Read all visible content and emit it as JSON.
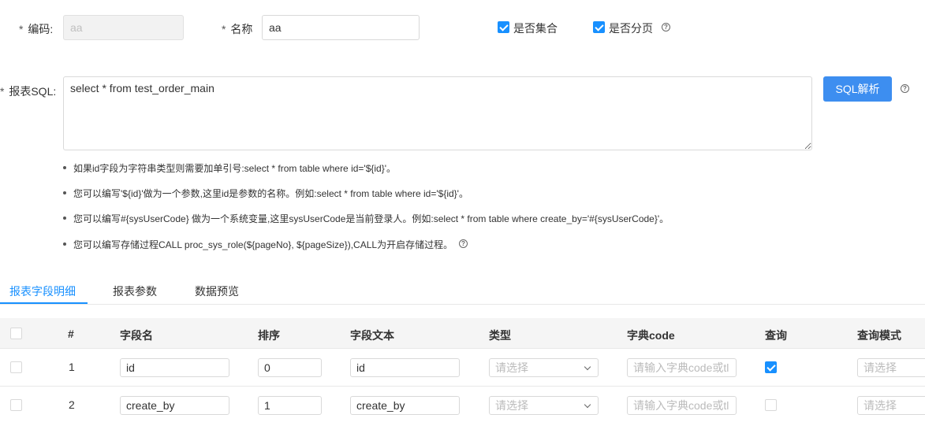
{
  "form": {
    "code_label": "编码:",
    "code_value": "aa",
    "name_label": "名称",
    "name_value": "aa",
    "is_collection_label": "是否集合",
    "is_collection_checked": true,
    "is_paged_label": "是否分页",
    "is_paged_checked": true,
    "sql_label": "报表SQL:",
    "sql_value": "select * from test_order_main",
    "sql_parse_button": "SQL解析",
    "required_mark": "*",
    "help_glyph": "?"
  },
  "tips": [
    "如果id字段为字符串类型则需要加单引号:select * from table where id='${id}'。",
    "您可以编写'${id}'做为一个参数,这里id是参数的名称。例如:select * from table where id='${id}'。",
    "您可以编写#{sysUserCode} 做为一个系统变量,这里sysUserCode是当前登录人。例如:select * from table where create_by='#{sysUserCode}'。",
    "您可以编写存储过程CALL proc_sys_role(${pageNo}, ${pageSize}),CALL为开启存储过程。"
  ],
  "tabs": [
    {
      "label": "报表字段明细",
      "active": true
    },
    {
      "label": "报表参数",
      "active": false
    },
    {
      "label": "数据预览",
      "active": false
    }
  ],
  "table": {
    "columns": [
      "#",
      "字段名",
      "排序",
      "字段文本",
      "类型",
      "字典code",
      "查询",
      "查询模式"
    ],
    "select_placeholder": "请选择",
    "dict_placeholder": "请输入字典code或tl",
    "rows": [
      {
        "index": "1",
        "field_name": "id",
        "order": "0",
        "field_text": "id",
        "query_checked": true
      },
      {
        "index": "2",
        "field_name": "create_by",
        "order": "1",
        "field_text": "create_by",
        "query_checked": false
      }
    ]
  },
  "colors": {
    "accent": "#1890ff",
    "button": "#3d8ef0"
  }
}
